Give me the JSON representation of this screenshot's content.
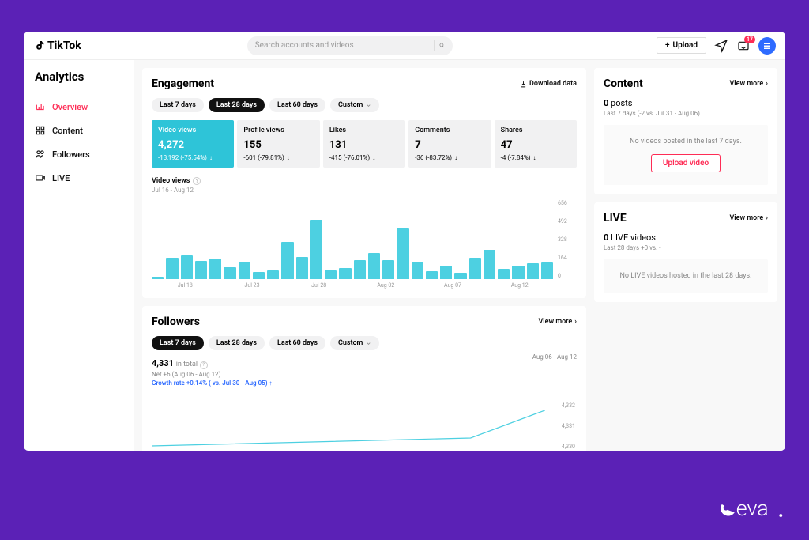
{
  "brand": "TikTok",
  "search": {
    "placeholder": "Search accounts and videos"
  },
  "header": {
    "upload_label": "Upload",
    "message_badge": "17"
  },
  "sidebar": {
    "title": "Analytics",
    "items": [
      {
        "label": "Overview",
        "active": true
      },
      {
        "label": "Content",
        "active": false
      },
      {
        "label": "Followers",
        "active": false
      },
      {
        "label": "LIVE",
        "active": false
      }
    ]
  },
  "engagement": {
    "title": "Engagement",
    "download": "Download data",
    "tabs": [
      "Last 7 days",
      "Last 28 days",
      "Last 60 days",
      "Custom"
    ],
    "active_tab": 1,
    "metrics": [
      {
        "label": "Video views",
        "value": "4,272",
        "delta": "-13,192 (-75.54%)",
        "active": true
      },
      {
        "label": "Profile views",
        "value": "155",
        "delta": "-601 (-79.81%)",
        "active": false
      },
      {
        "label": "Likes",
        "value": "131",
        "delta": "-415 (-76.01%)",
        "active": false
      },
      {
        "label": "Comments",
        "value": "7",
        "delta": "-36 (-83.72%)",
        "active": false
      },
      {
        "label": "Shares",
        "value": "47",
        "delta": "-4 (-7.84%)",
        "active": false
      }
    ],
    "chart_label": "Video views",
    "chart_range": "Jul 16 - Aug 12"
  },
  "followers": {
    "title": "Followers",
    "view_more": "View more",
    "tabs": [
      "Last 7 days",
      "Last 28 days",
      "Last 60 days",
      "Custom"
    ],
    "active_tab": 0,
    "total": "4,331",
    "total_label": "in total",
    "net": "Net +6 (Aug 06 - Aug 12)",
    "growth": "Growth rate +0.14% ( vs. Jul 30 - Aug 05)",
    "date_range": "Aug 06 - Aug 12",
    "y_labels": [
      "4,332",
      "4,331",
      "4,330"
    ]
  },
  "content_card": {
    "title": "Content",
    "view_more": "View more",
    "count": "0",
    "count_label": "posts",
    "sub": "Last 7 days (-2 vs. Jul 31 - Aug 06)",
    "empty": "No videos posted in the last 7 days.",
    "btn": "Upload video"
  },
  "live_card": {
    "title": "LIVE",
    "view_more": "View more",
    "count": "0",
    "count_label": "LIVE videos",
    "sub": "Last 28 days +0 vs. -",
    "empty": "No LIVE videos hosted in the last 28 days."
  },
  "chart_data": {
    "type": "bar",
    "title": "Video views",
    "date_range": "Jul 16 - Aug 12",
    "x_tick_labels": [
      "Jul 18",
      "Jul 23",
      "Jul 28",
      "Aug 02",
      "Aug 07",
      "Aug 12"
    ],
    "y_tick_labels": [
      "0",
      "164",
      "328",
      "492",
      "656"
    ],
    "ylim": [
      0,
      656
    ],
    "values": [
      20,
      180,
      200,
      150,
      170,
      100,
      140,
      60,
      70,
      310,
      185,
      490,
      70,
      90,
      155,
      215,
      160,
      420,
      140,
      65,
      110,
      55,
      175,
      240,
      85,
      110,
      130,
      140
    ]
  },
  "watermark": "eva"
}
